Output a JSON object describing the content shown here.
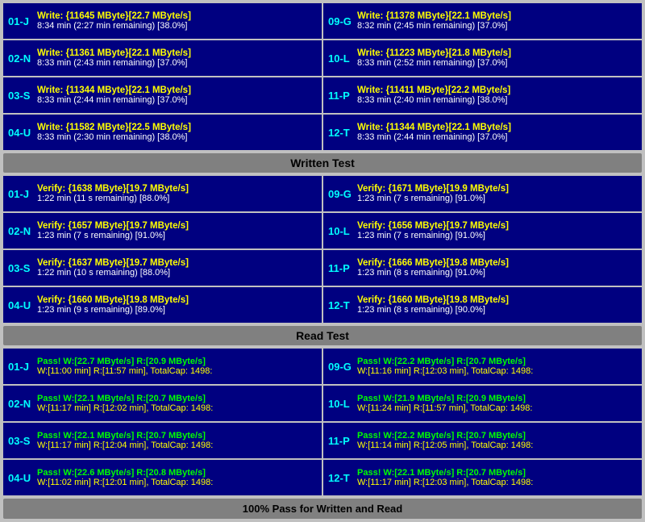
{
  "sections": {
    "write_test_label": "Written Test",
    "read_test_label": "Read Test",
    "footer_label": "100% Pass for Written and Read"
  },
  "write_rows": [
    {
      "left": {
        "id": "01-J",
        "line1": "Write: {11645 MByte}[22.7 MByte/s]",
        "line2": "8:34 min (2:27 min remaining)  [38.0%]"
      },
      "right": {
        "id": "09-G",
        "line1": "Write: {11378 MByte}[22.1 MByte/s]",
        "line2": "8:32 min (2:45 min remaining)  [37.0%]"
      }
    },
    {
      "left": {
        "id": "02-N",
        "line1": "Write: {11361 MByte}[22.1 MByte/s]",
        "line2": "8:33 min (2:43 min remaining)  [37.0%]"
      },
      "right": {
        "id": "10-L",
        "line1": "Write: {11223 MByte}[21.8 MByte/s]",
        "line2": "8:33 min (2:52 min remaining)  [37.0%]"
      }
    },
    {
      "left": {
        "id": "03-S",
        "line1": "Write: {11344 MByte}[22.1 MByte/s]",
        "line2": "8:33 min (2:44 min remaining)  [37.0%]"
      },
      "right": {
        "id": "11-P",
        "line1": "Write: {11411 MByte}[22.2 MByte/s]",
        "line2": "8:33 min (2:40 min remaining)  [38.0%]"
      }
    },
    {
      "left": {
        "id": "04-U",
        "line1": "Write: {11582 MByte}[22.5 MByte/s]",
        "line2": "8:33 min (2:30 min remaining)  [38.0%]"
      },
      "right": {
        "id": "12-T",
        "line1": "Write: {11344 MByte}[22.1 MByte/s]",
        "line2": "8:33 min (2:44 min remaining)  [37.0%]"
      }
    }
  ],
  "verify_rows": [
    {
      "left": {
        "id": "01-J",
        "line1": "Verify: {1638 MByte}[19.7 MByte/s]",
        "line2": "1:22 min (11 s remaining)   [88.0%]"
      },
      "right": {
        "id": "09-G",
        "line1": "Verify: {1671 MByte}[19.9 MByte/s]",
        "line2": "1:23 min (7 s remaining)   [91.0%]"
      }
    },
    {
      "left": {
        "id": "02-N",
        "line1": "Verify: {1657 MByte}[19.7 MByte/s]",
        "line2": "1:23 min (7 s remaining)   [91.0%]"
      },
      "right": {
        "id": "10-L",
        "line1": "Verify: {1656 MByte}[19.7 MByte/s]",
        "line2": "1:23 min (7 s remaining)   [91.0%]"
      }
    },
    {
      "left": {
        "id": "03-S",
        "line1": "Verify: {1637 MByte}[19.7 MByte/s]",
        "line2": "1:22 min (10 s remaining)   [88.0%]"
      },
      "right": {
        "id": "11-P",
        "line1": "Verify: {1666 MByte}[19.8 MByte/s]",
        "line2": "1:23 min (8 s remaining)   [91.0%]"
      }
    },
    {
      "left": {
        "id": "04-U",
        "line1": "Verify: {1660 MByte}[19.8 MByte/s]",
        "line2": "1:23 min (9 s remaining)   [89.0%]"
      },
      "right": {
        "id": "12-T",
        "line1": "Verify: {1660 MByte}[19.8 MByte/s]",
        "line2": "1:23 min (8 s remaining)   [90.0%]"
      }
    }
  ],
  "pass_rows": [
    {
      "left": {
        "id": "01-J",
        "line1": "Pass! W:[22.7 MByte/s] R:[20.9 MByte/s]",
        "line2": "W:[11:00 min] R:[11:57 min], TotalCap: 1498:"
      },
      "right": {
        "id": "09-G",
        "line1": "Pass! W:[22.2 MByte/s] R:[20.7 MByte/s]",
        "line2": "W:[11:16 min] R:[12:03 min], TotalCap: 1498:"
      }
    },
    {
      "left": {
        "id": "02-N",
        "line1": "Pass! W:[22.1 MByte/s] R:[20.7 MByte/s]",
        "line2": "W:[11:17 min] R:[12:02 min], TotalCap: 1498:"
      },
      "right": {
        "id": "10-L",
        "line1": "Pass! W:[21.9 MByte/s] R:[20.9 MByte/s]",
        "line2": "W:[11:24 min] R:[11:57 min], TotalCap: 1498:"
      }
    },
    {
      "left": {
        "id": "03-S",
        "line1": "Pass! W:[22.1 MByte/s] R:[20.7 MByte/s]",
        "line2": "W:[11:17 min] R:[12:04 min], TotalCap: 1498:"
      },
      "right": {
        "id": "11-P",
        "line1": "Pass! W:[22.2 MByte/s] R:[20.7 MByte/s]",
        "line2": "W:[11:14 min] R:[12:05 min], TotalCap: 1498:"
      }
    },
    {
      "left": {
        "id": "04-U",
        "line1": "Pass! W:[22.6 MByte/s] R:[20.8 MByte/s]",
        "line2": "W:[11:02 min] R:[12:01 min], TotalCap: 1498:"
      },
      "right": {
        "id": "12-T",
        "line1": "Pass! W:[22.1 MByte/s] R:[20.7 MByte/s]",
        "line2": "W:[11:17 min] R:[12:03 min], TotalCap: 1498:"
      }
    }
  ]
}
